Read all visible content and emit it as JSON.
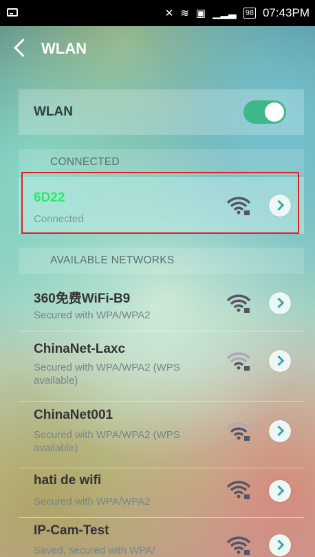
{
  "status_bar": {
    "time": "07:43PM",
    "battery": "98"
  },
  "header": {
    "title": "WLAN"
  },
  "wlan_toggle": {
    "label": "WLAN",
    "state": "on",
    "color": "#3fb889"
  },
  "connected_section": {
    "header": "CONNECTED"
  },
  "connected_network": {
    "name": "6D22",
    "status": "Connected",
    "name_color": "#2ee86b"
  },
  "available_section": {
    "header": "AVAILABLE NETWORKS"
  },
  "networks": [
    {
      "name": "360免费WiFi-B9",
      "sub": "Secured with WPA/WPA2"
    },
    {
      "name": "ChinaNet-Laxc",
      "sub": "Secured with WPA/WPA2 (WPS available)"
    },
    {
      "name": "ChinaNet001",
      "sub": "Secured with WPA/WPA2 (WPS available)"
    },
    {
      "name": "hati de wifi",
      "sub": "Secured with WPA/WPA2"
    },
    {
      "name": "IP-Cam-Test",
      "sub": "Saved, secured with WPA/"
    }
  ]
}
